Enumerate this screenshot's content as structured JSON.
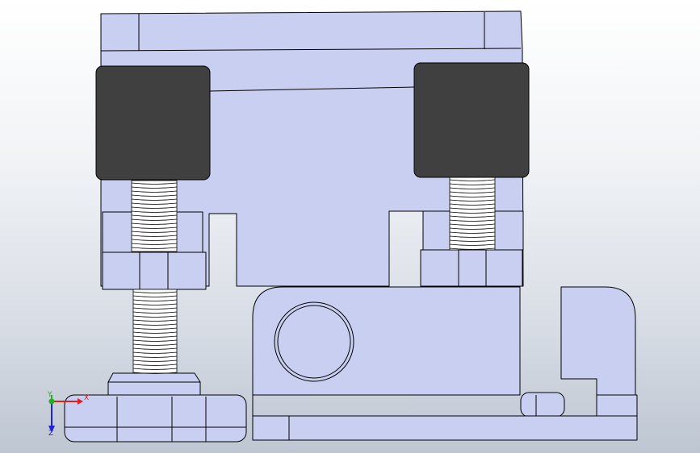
{
  "viewport": {
    "background_top": "#ffffff",
    "background_bottom": "#bec6d2"
  },
  "model": {
    "part_fill": "#c9cff0",
    "part_fill_light": "#d2d7f4",
    "edge_color": "#000000",
    "pad_fill": "#404040",
    "thread_fill": "#ffffff"
  },
  "triad": {
    "x_label": "X",
    "y_label": "Y",
    "z_label": "Z",
    "x_color": "#e02020",
    "y_color": "#20b020",
    "z_color": "#2020e0"
  }
}
